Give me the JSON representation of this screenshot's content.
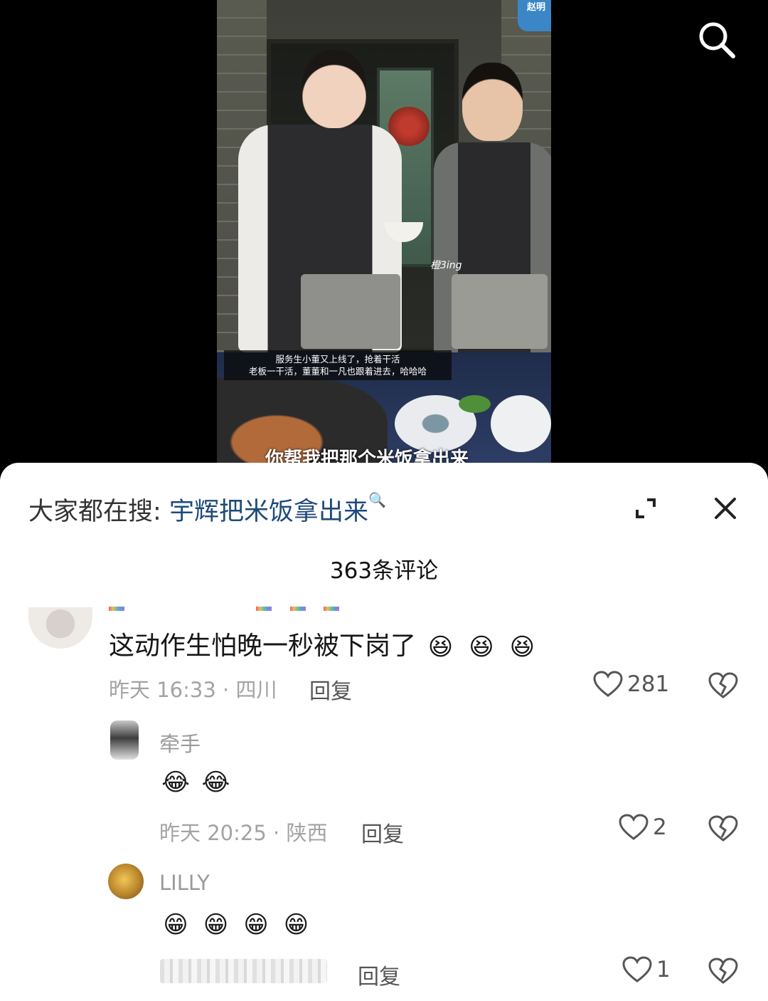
{
  "video": {
    "watermark": "赵明",
    "caption_line1": "服务生小董又上线了，抢着干活",
    "caption_line2": "老板一干活，董董和一凡也跟着进去，哈哈哈",
    "subtitle": "你帮我把那个米饭拿出来",
    "handwriting": "橙3ing",
    "search_icon": "search-icon"
  },
  "sheet": {
    "search_prefix": "大家都在搜:",
    "search_keyword": "宇辉把米饭拿出来",
    "search_keyword_icon": "🔍",
    "expand_icon": "expand-icon",
    "close_icon": "close-icon",
    "comment_count": "363条评论"
  },
  "comments": [
    {
      "text": "这动作生怕晚一秒被下岗了",
      "emojis": [
        "😆",
        "😆",
        "😆"
      ],
      "meta": "昨天 16:33 · 四川",
      "reply_label": "回复",
      "likes": "281"
    }
  ],
  "replies": [
    {
      "name": "牵手",
      "emojis": [
        "😂",
        "😂"
      ],
      "meta": "昨天 20:25 · 陕西",
      "reply_label": "回复",
      "likes": "2"
    },
    {
      "name": "LILLY",
      "emojis": [
        "😁",
        "😁",
        "😁",
        "😁"
      ],
      "reply_label": "回复",
      "likes": "1"
    }
  ],
  "colors": {
    "keyword": "#1f4a7a",
    "meta": "#a3a3a3"
  }
}
